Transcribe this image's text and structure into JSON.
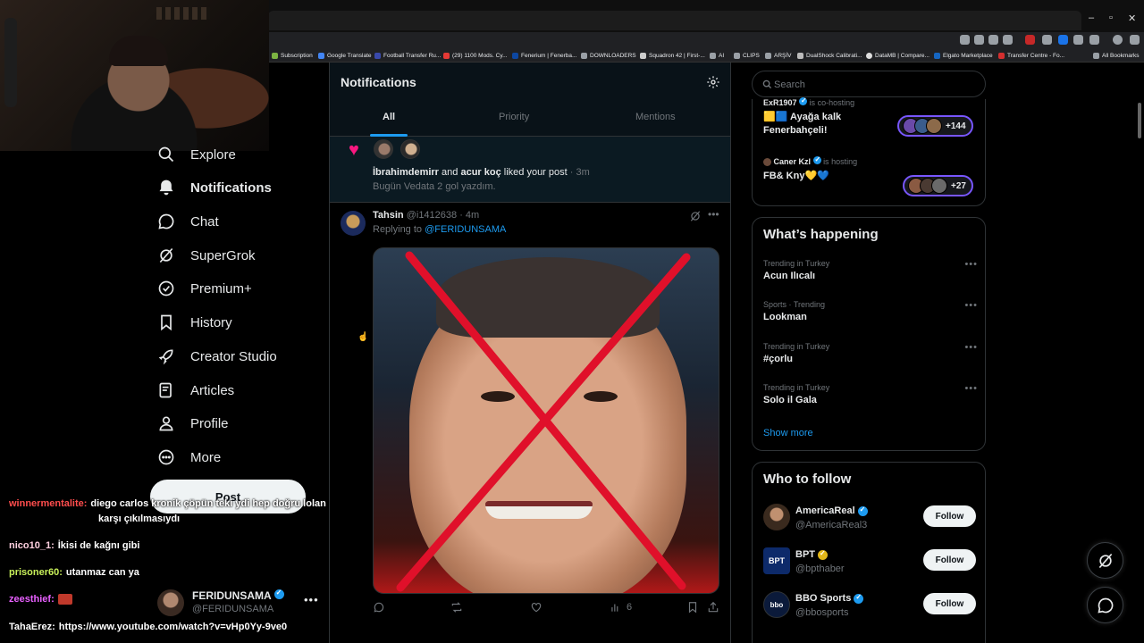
{
  "browser": {
    "bookmarks": [
      "Subscription",
      "Google Translate",
      "Football Transfer Ru...",
      "(29) 1100 Mods. Cy...",
      "Fenerium | Fenerba...",
      "DOWNLOADERS",
      "Squadron 42 | First-...",
      "AI",
      "CLIPS",
      "ARŞİV",
      "DualShock Calibrati...",
      "DataMB | Compare...",
      "Elgato Marketplace",
      "Transfer Centre - Fo...",
      "All Bookmarks"
    ]
  },
  "sidebar": {
    "items": [
      {
        "label": "Explore",
        "icon": "search-icon"
      },
      {
        "label": "Notifications",
        "icon": "bell-icon"
      },
      {
        "label": "Chat",
        "icon": "chat-icon"
      },
      {
        "label": "SuperGrok",
        "icon": "grok-icon"
      },
      {
        "label": "Premium+",
        "icon": "verified-badge-icon"
      },
      {
        "label": "History",
        "icon": "bookmark-icon"
      },
      {
        "label": "Creator Studio",
        "icon": "rocket-icon"
      },
      {
        "label": "Articles",
        "icon": "article-icon"
      },
      {
        "label": "Profile",
        "icon": "person-icon"
      },
      {
        "label": "More",
        "icon": "more-circle-icon"
      }
    ],
    "post_label": "Post",
    "account": {
      "name": "FERIDUNSAMA",
      "handle": "@FERIDUNSAMA"
    }
  },
  "chat_overlay": [
    {
      "user": "winnermentalite:",
      "text": "diego carlos kronik çöpün teki ydi hep doğru lolan",
      "text2": "karşı çıkılmasıydı",
      "color": "#ff4d4d"
    },
    {
      "user": "nico10_1:",
      "text": "İkisi de kağnı gibi",
      "color": "#ffd0e0"
    },
    {
      "user": "prisoner60:",
      "text": "utanmaz can ya",
      "color": "#c8f05a"
    },
    {
      "user": "zeesthief:",
      "text": "",
      "color": "#e860ff"
    },
    {
      "user": "TahaErez:",
      "text": "https://www.youtube.com/watch?v=vHp0Yy-9ve0",
      "color": "#ffffff"
    }
  ],
  "notifications": {
    "title": "Notifications",
    "tabs": [
      "All",
      "Priority",
      "Mentions"
    ],
    "active_tab": "All",
    "like_notification": {
      "user1": "İbrahimdemirr",
      "conj": "and",
      "user2": "acur koç",
      "action": "liked your post",
      "time": "· 3m",
      "post_text": "Bugün Vedata 2 gol yazdım."
    },
    "reply": {
      "name": "Tahsin",
      "handle": "@i1412638",
      "time": "· 4m",
      "replying_prefix": "Replying to",
      "replying_to": "@FERIDUNSAMA",
      "views": "6"
    }
  },
  "right": {
    "search_placeholder": "Search",
    "spaces": [
      {
        "host": "ExR1907",
        "status": "is co-hosting",
        "title": "🟨🟦 Ayağa kalk Fenerbahçeli!",
        "count": "+144"
      },
      {
        "host": "Caner Kzl",
        "status": "is hosting",
        "title": "FB& Kny💛💙",
        "count": "+27"
      }
    ],
    "happening_title": "What’s happening",
    "trends": [
      {
        "context": "Trending in Turkey",
        "name": "Acun Ilıcalı"
      },
      {
        "context": "Sports · Trending",
        "name": "Lookman"
      },
      {
        "context": "Trending in Turkey",
        "name": "#çorlu"
      },
      {
        "context": "Trending in Turkey",
        "name": "Solo il Gala"
      }
    ],
    "show_more": "Show more",
    "who_to_follow_title": "Who to follow",
    "follow": [
      {
        "name": "AmericaReal",
        "handle": "@AmericaReal3",
        "badge": "#1d9bf0",
        "button": "Follow"
      },
      {
        "name": "BPT",
        "handle": "@bpthaber",
        "badge": "#e2b719",
        "button": "Follow"
      },
      {
        "name": "BBO Sports",
        "handle": "@bbosports",
        "badge": "#1d9bf0",
        "button": "Follow"
      }
    ]
  },
  "colors": {
    "accent": "#1d9bf0",
    "like": "#f91880",
    "spaces": "#7856ff",
    "gold_badge": "#e2b719"
  }
}
